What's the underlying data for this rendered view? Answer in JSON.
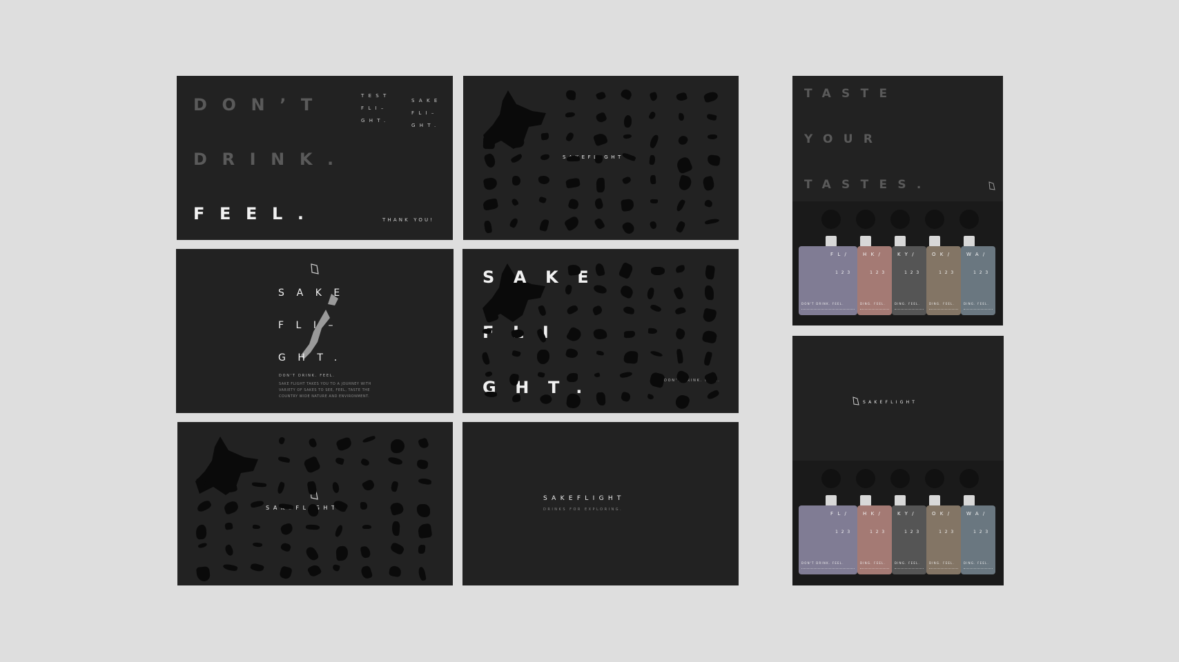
{
  "slide1": {
    "line1": "DON’T",
    "line2": "DRINK.",
    "line3": "FEEL.",
    "col_a": [
      "TEST",
      "FLI–",
      "GHT."
    ],
    "col_b": [
      "SAKE",
      "FLI–",
      "GHT."
    ],
    "thanks": "THANK YOU!"
  },
  "slide2": {
    "brand": "SAKEFLIGHT"
  },
  "slide3": {
    "l1": "SAKE",
    "l2": "FLI–",
    "l3": "GHT.",
    "tagline": "DON'T DRINK. FEEL.",
    "body1": "SAKE FLIGHT TAKES YOU TO A JOURNEY WITH",
    "body2": "VARIETY OF SAKES TO SEE, FEEL, TASTE THE",
    "body3": "COUNTRY WIDE NATURE AND ENVIRONMENT."
  },
  "slide4": {
    "l1": "SAKE",
    "l2": "FLI–",
    "l3": "GHT.",
    "tagline": "DON'T DRINK. FEEL."
  },
  "slide5": {
    "brand": "SAKEFLIGHT"
  },
  "slide6": {
    "brand": "SAKEFLIGHT",
    "sub": "DRINKS FOR EXPLORING."
  },
  "poster1": {
    "line1": "TASTE",
    "line2": "YOUR",
    "line3": "TASTES."
  },
  "poster2": {
    "brand": "SAKEFLIGHT"
  },
  "pouches": [
    {
      "label": "FL/",
      "nums": "123",
      "foot": "DON'T DRINK. FEEL.",
      "color": "#807c94"
    },
    {
      "label": "HK/",
      "nums": "123",
      "foot": "DING. FEEL.",
      "color": "#a47a74"
    },
    {
      "label": "KY/",
      "nums": "123",
      "foot": "DING. FEEL.",
      "color": "#555555"
    },
    {
      "label": "OK/",
      "nums": "123",
      "foot": "DING. FEEL.",
      "color": "#837565"
    },
    {
      "label": "WA/",
      "nums": "123",
      "foot": "DING. FEEL.",
      "color": "#6a7780"
    }
  ],
  "colors": {
    "background": "#dedede",
    "card": "#222222",
    "silhouette": "#0a0a0a"
  }
}
